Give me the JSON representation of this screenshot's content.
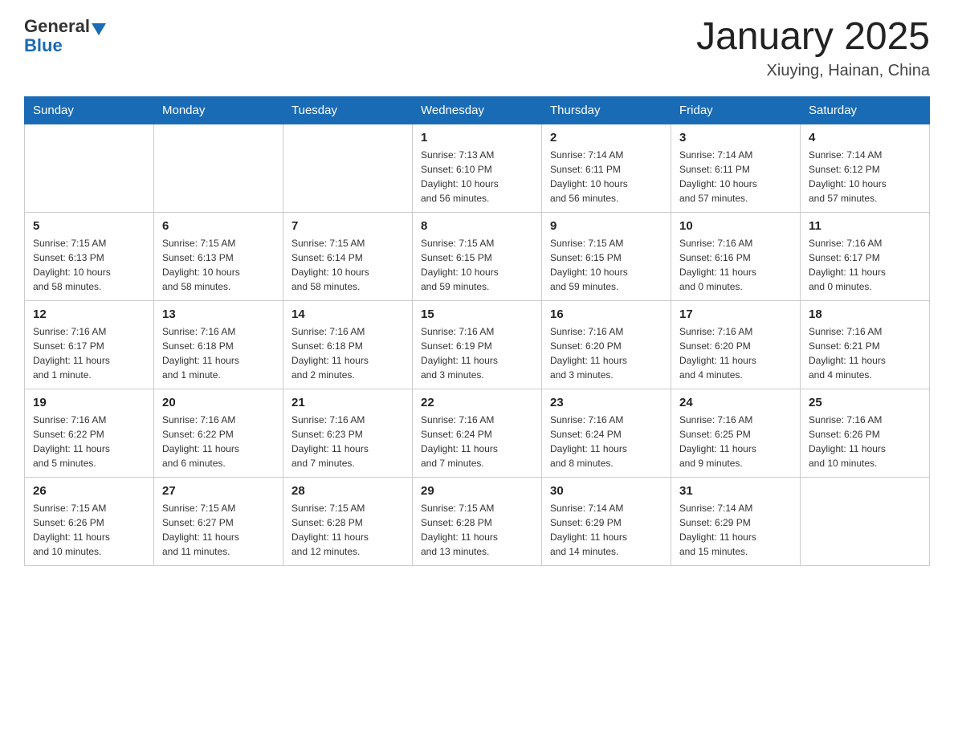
{
  "header": {
    "logo_general": "General",
    "logo_blue": "Blue",
    "title": "January 2025",
    "location": "Xiuying, Hainan, China"
  },
  "days_of_week": [
    "Sunday",
    "Monday",
    "Tuesday",
    "Wednesday",
    "Thursday",
    "Friday",
    "Saturday"
  ],
  "weeks": [
    [
      {
        "day": "",
        "info": ""
      },
      {
        "day": "",
        "info": ""
      },
      {
        "day": "",
        "info": ""
      },
      {
        "day": "1",
        "info": "Sunrise: 7:13 AM\nSunset: 6:10 PM\nDaylight: 10 hours\nand 56 minutes."
      },
      {
        "day": "2",
        "info": "Sunrise: 7:14 AM\nSunset: 6:11 PM\nDaylight: 10 hours\nand 56 minutes."
      },
      {
        "day": "3",
        "info": "Sunrise: 7:14 AM\nSunset: 6:11 PM\nDaylight: 10 hours\nand 57 minutes."
      },
      {
        "day": "4",
        "info": "Sunrise: 7:14 AM\nSunset: 6:12 PM\nDaylight: 10 hours\nand 57 minutes."
      }
    ],
    [
      {
        "day": "5",
        "info": "Sunrise: 7:15 AM\nSunset: 6:13 PM\nDaylight: 10 hours\nand 58 minutes."
      },
      {
        "day": "6",
        "info": "Sunrise: 7:15 AM\nSunset: 6:13 PM\nDaylight: 10 hours\nand 58 minutes."
      },
      {
        "day": "7",
        "info": "Sunrise: 7:15 AM\nSunset: 6:14 PM\nDaylight: 10 hours\nand 58 minutes."
      },
      {
        "day": "8",
        "info": "Sunrise: 7:15 AM\nSunset: 6:15 PM\nDaylight: 10 hours\nand 59 minutes."
      },
      {
        "day": "9",
        "info": "Sunrise: 7:15 AM\nSunset: 6:15 PM\nDaylight: 10 hours\nand 59 minutes."
      },
      {
        "day": "10",
        "info": "Sunrise: 7:16 AM\nSunset: 6:16 PM\nDaylight: 11 hours\nand 0 minutes."
      },
      {
        "day": "11",
        "info": "Sunrise: 7:16 AM\nSunset: 6:17 PM\nDaylight: 11 hours\nand 0 minutes."
      }
    ],
    [
      {
        "day": "12",
        "info": "Sunrise: 7:16 AM\nSunset: 6:17 PM\nDaylight: 11 hours\nand 1 minute."
      },
      {
        "day": "13",
        "info": "Sunrise: 7:16 AM\nSunset: 6:18 PM\nDaylight: 11 hours\nand 1 minute."
      },
      {
        "day": "14",
        "info": "Sunrise: 7:16 AM\nSunset: 6:18 PM\nDaylight: 11 hours\nand 2 minutes."
      },
      {
        "day": "15",
        "info": "Sunrise: 7:16 AM\nSunset: 6:19 PM\nDaylight: 11 hours\nand 3 minutes."
      },
      {
        "day": "16",
        "info": "Sunrise: 7:16 AM\nSunset: 6:20 PM\nDaylight: 11 hours\nand 3 minutes."
      },
      {
        "day": "17",
        "info": "Sunrise: 7:16 AM\nSunset: 6:20 PM\nDaylight: 11 hours\nand 4 minutes."
      },
      {
        "day": "18",
        "info": "Sunrise: 7:16 AM\nSunset: 6:21 PM\nDaylight: 11 hours\nand 4 minutes."
      }
    ],
    [
      {
        "day": "19",
        "info": "Sunrise: 7:16 AM\nSunset: 6:22 PM\nDaylight: 11 hours\nand 5 minutes."
      },
      {
        "day": "20",
        "info": "Sunrise: 7:16 AM\nSunset: 6:22 PM\nDaylight: 11 hours\nand 6 minutes."
      },
      {
        "day": "21",
        "info": "Sunrise: 7:16 AM\nSunset: 6:23 PM\nDaylight: 11 hours\nand 7 minutes."
      },
      {
        "day": "22",
        "info": "Sunrise: 7:16 AM\nSunset: 6:24 PM\nDaylight: 11 hours\nand 7 minutes."
      },
      {
        "day": "23",
        "info": "Sunrise: 7:16 AM\nSunset: 6:24 PM\nDaylight: 11 hours\nand 8 minutes."
      },
      {
        "day": "24",
        "info": "Sunrise: 7:16 AM\nSunset: 6:25 PM\nDaylight: 11 hours\nand 9 minutes."
      },
      {
        "day": "25",
        "info": "Sunrise: 7:16 AM\nSunset: 6:26 PM\nDaylight: 11 hours\nand 10 minutes."
      }
    ],
    [
      {
        "day": "26",
        "info": "Sunrise: 7:15 AM\nSunset: 6:26 PM\nDaylight: 11 hours\nand 10 minutes."
      },
      {
        "day": "27",
        "info": "Sunrise: 7:15 AM\nSunset: 6:27 PM\nDaylight: 11 hours\nand 11 minutes."
      },
      {
        "day": "28",
        "info": "Sunrise: 7:15 AM\nSunset: 6:28 PM\nDaylight: 11 hours\nand 12 minutes."
      },
      {
        "day": "29",
        "info": "Sunrise: 7:15 AM\nSunset: 6:28 PM\nDaylight: 11 hours\nand 13 minutes."
      },
      {
        "day": "30",
        "info": "Sunrise: 7:14 AM\nSunset: 6:29 PM\nDaylight: 11 hours\nand 14 minutes."
      },
      {
        "day": "31",
        "info": "Sunrise: 7:14 AM\nSunset: 6:29 PM\nDaylight: 11 hours\nand 15 minutes."
      },
      {
        "day": "",
        "info": ""
      }
    ]
  ]
}
